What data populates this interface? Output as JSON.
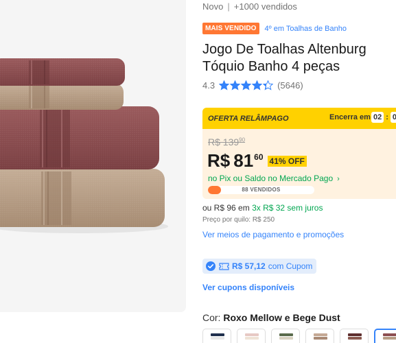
{
  "product": {
    "condition": "Novo",
    "separator": "|",
    "sold": "+1000 vendidos",
    "badge_top": "MAIS VENDIDO",
    "badge_rank": "4º em Toalhas de Banho",
    "title": "Jogo De Toalhas Altenburg Tóquio Banho 4 peças",
    "rating_score": "4.3",
    "rating_value": 4.3,
    "rating_count": "(5646)"
  },
  "deal": {
    "flash_label": "OFERTA RELÂMPAGO",
    "ends_label": "Encerra em",
    "timer_hours": "02",
    "timer_colon": ":",
    "timer_minutes": "0",
    "old_price_int": "R$ 139",
    "old_price_cents": "90",
    "price_currency": "R$",
    "price_int": "81",
    "price_cents": "60",
    "discount": "41% OFF",
    "pix_text": "no Pix ou Saldo no Mercado Pago",
    "pix_chevron": "›",
    "sold_label": "88 VENDIDOS",
    "sold_fraction": 0.12
  },
  "payment": {
    "or_price": "ou R$ 96 em",
    "installments": "3x R$ 32 sem juros",
    "per_kilo": "Preço por quilo: R$ 250",
    "payment_link": "Ver meios de pagamento e promoções",
    "coupon_amount": "R$ 57,12",
    "coupon_with": "com Cupom",
    "coupons_link": "Ver cupons disponíveis"
  },
  "variant": {
    "color_label": "Cor:",
    "color_value": "Roxo Mellow e Bege Dust"
  },
  "colors": {
    "accent_blue": "#3483fa",
    "green": "#00a650",
    "orange": "#ff7733",
    "yellow": "#ffd100",
    "towel_mauve": "#8c4e50",
    "towel_beige": "#b79e86"
  },
  "icons": {
    "star": "star-icon",
    "coupon_check": "check-circle-icon",
    "coupon_ticket": "ticket-icon"
  }
}
